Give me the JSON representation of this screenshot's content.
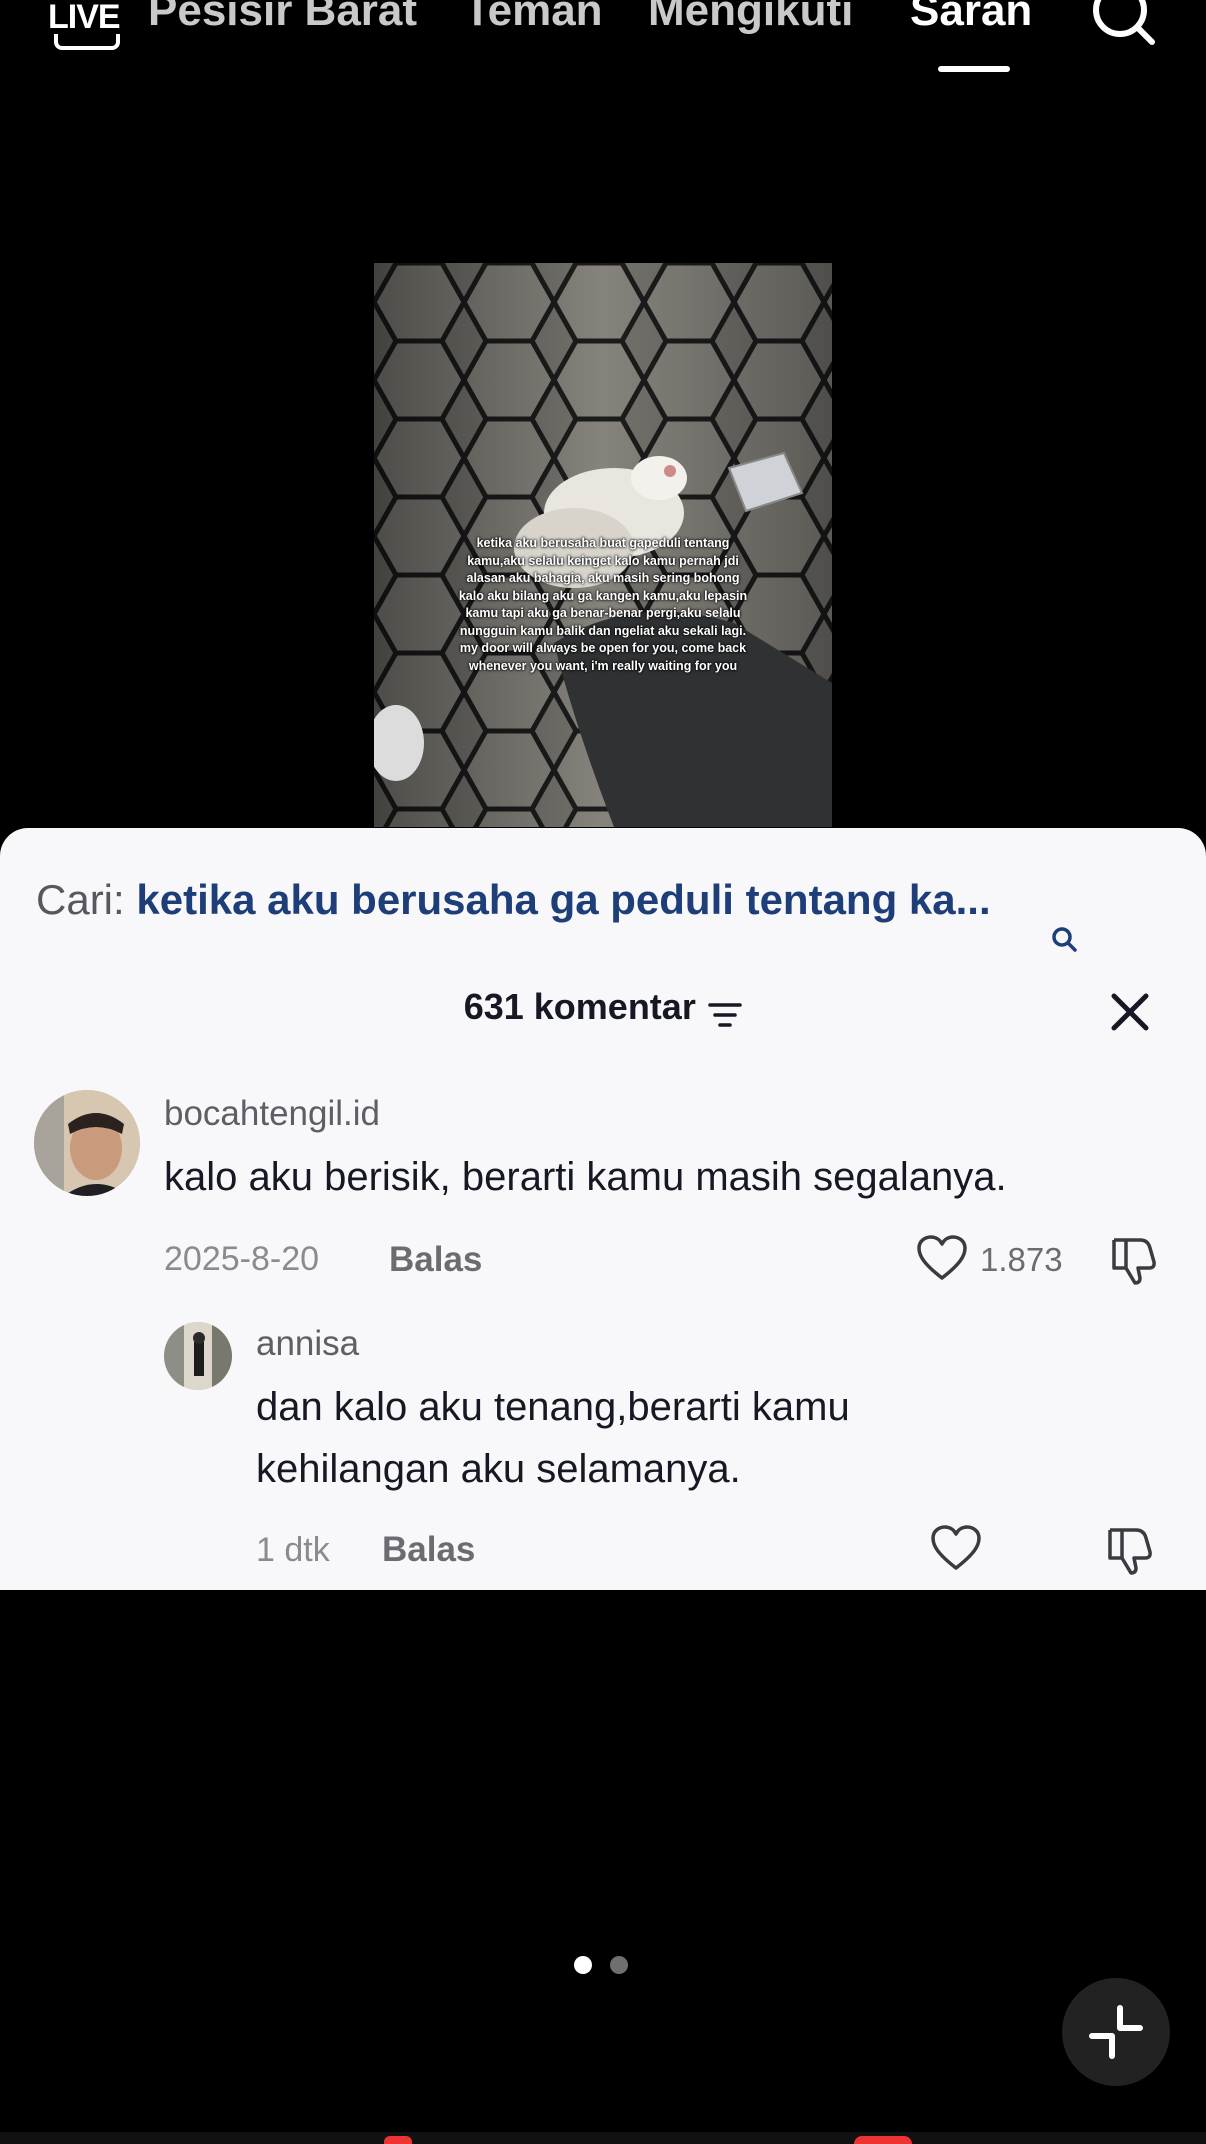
{
  "nav": {
    "live_label": "LIVE",
    "tabs": [
      {
        "label": "Pesisir Barat",
        "active": false
      },
      {
        "label": "Teman",
        "active": false
      },
      {
        "label": "Mengikuti",
        "active": false
      },
      {
        "label": "Saran",
        "active": true
      }
    ],
    "search_icon": "search-icon"
  },
  "video": {
    "caption_lines": [
      "ketika aku berusaha buat gapeduli tentang",
      "kamu,aku selalu keinget kalo kamu pernah jdi",
      "alasan aku bahagia, aku masih sering bohong",
      "kalo aku bilang aku ga kangen kamu,aku lepasin",
      "kamu tapi aku ga benar-benar pergi,aku selalu",
      "nungguin kamu balik dan ngeliat aku sekali lagi.",
      "my door will always be open for you, come back",
      "whenever you want, i'm really waiting for you"
    ]
  },
  "sheet": {
    "search_prefix": "Cari: ",
    "search_query": "ketika aku berusaha ga peduli tentang ka...",
    "comments_count": "631 komentar",
    "comments": [
      {
        "username": "bocahtengil.id",
        "text": "kalo aku berisik, berarti kamu masih segalanya.",
        "date": "2025-8-20",
        "reply_label": "Balas",
        "likes": "1.873"
      },
      {
        "username": "annisa",
        "text": "dan kalo aku tenang,berarti kamu kehilangan aku selamanya.",
        "date": "1 dtk",
        "reply_label": "Balas",
        "likes": ""
      }
    ]
  },
  "colors": {
    "sheet_bg": "#f8f8fa",
    "query_color": "#1d3e78",
    "accent_red": "#e33333"
  },
  "pager": {
    "count": 2,
    "active_index": 0
  }
}
